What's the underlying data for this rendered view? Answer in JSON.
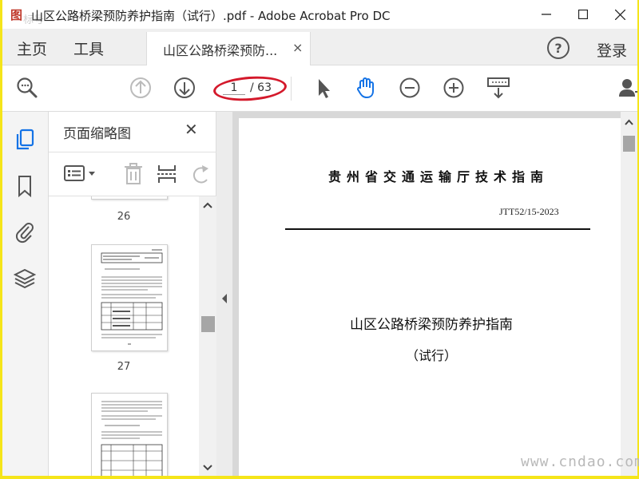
{
  "window": {
    "logo_glyph": "图",
    "watermark_top": "标号",
    "title": "山区公路桥梁预防养护指南（试行）.pdf - Adobe Acrobat Pro DC"
  },
  "tabs": {
    "home": "主页",
    "tools": "工具",
    "document": "山区公路桥梁预防...",
    "close": "×",
    "help": "?",
    "login": "登录"
  },
  "toolbar": {
    "current_page": "1",
    "total_pages": "/ 63",
    "highlight_color": "#d4192b"
  },
  "thumbnails": {
    "title": "页面缩略图",
    "close": "✕",
    "pages": [
      {
        "number": "26"
      },
      {
        "number": "27"
      },
      {
        "number": ""
      }
    ]
  },
  "document": {
    "header": "贵州省交通运输厅技术指南",
    "code": "JTT52/15-2023",
    "title": "山区公路桥梁预防养护指南",
    "subtitle": "（试行）"
  },
  "watermark_bottom": "www.cndao.com",
  "colors": {
    "accent": "#1473e6",
    "icon": "#555555"
  }
}
